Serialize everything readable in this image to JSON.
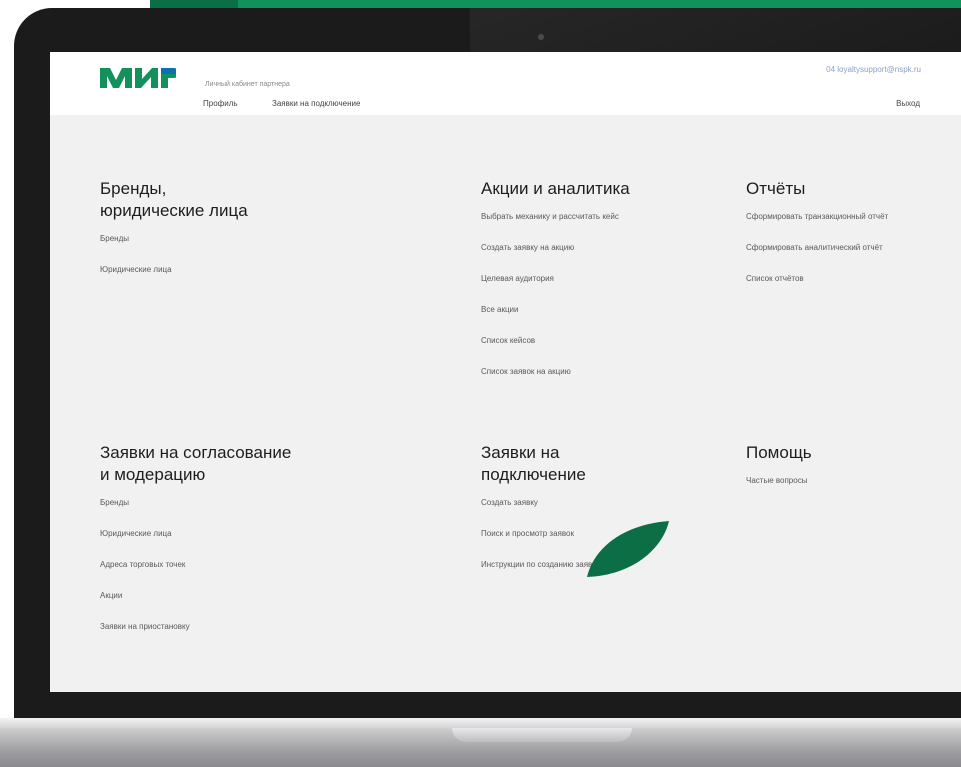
{
  "header": {
    "brand": "МИР",
    "cabinet_label": "Личный кабинет партнера",
    "nav": [
      "Профиль",
      "Заявки на подключение"
    ],
    "email": "04 loyaltysupport@nspk.ru",
    "logout": "Выход"
  },
  "sections": [
    {
      "title": [
        "Бренды,",
        "юридические лица"
      ],
      "items": [
        "Бренды",
        "Юридические лица"
      ]
    },
    {
      "title": [
        "Акции и аналитика"
      ],
      "items": [
        "Выбрать механику и рассчитать кейс",
        "Создать заявку на акцию",
        "Целевая аудитория",
        "Все акции",
        "Список кейсов",
        "Список заявок на акцию"
      ]
    },
    {
      "title": [
        "Отчёты"
      ],
      "items": [
        "Сформировать транзакционный отчёт",
        "Сформировать аналитический отчёт",
        "Список отчётов"
      ]
    },
    {
      "title": [
        "Заявки на согласование",
        "и модерацию"
      ],
      "items": [
        "Бренды",
        "Юридические лица",
        "Адреса торговых точек",
        "Акции",
        "Заявки на приостановку"
      ]
    },
    {
      "title": [
        "Заявки на",
        "подключение"
      ],
      "items": [
        "Создать заявку",
        "Поиск и просмотр заявок",
        "Инструкции по созданию заявки"
      ]
    },
    {
      "title": [
        "Помощь"
      ],
      "items": [
        "Частые вопросы"
      ]
    }
  ],
  "colors": {
    "brand_green": "#13915a",
    "brand_dark_green": "#0c6e44",
    "screen_bg": "#f1f1f1",
    "bezel": "#1b1b1c"
  }
}
